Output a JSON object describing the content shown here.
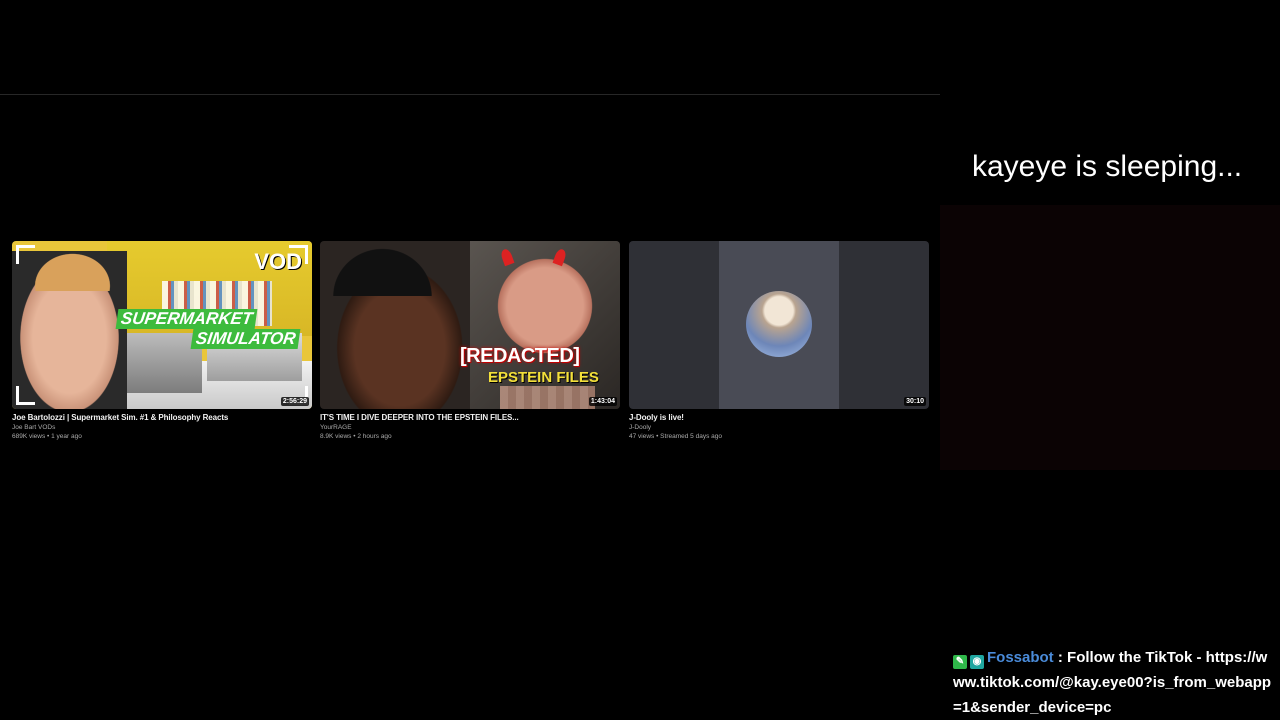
{
  "videos": [
    {
      "title": "Joe Bartolozzi | Supermarket Sim. #1 & Philosophy Reacts",
      "channel": "Joe Bart VODs",
      "stats": "689K views • 1 year ago",
      "duration": "2:56:29",
      "thumb_text": [
        "VOD",
        "SUPERMARKET",
        "SIMULATOR"
      ]
    },
    {
      "title": "IT'S TIME I DIVE DEEPER INTO THE EPSTEIN FILES...",
      "channel": "YourRAGE",
      "stats": "8.9K views • 2 hours ago",
      "duration": "1:43:04",
      "thumb_text": [
        "[REDACTED]",
        "EPSTEIN FILES"
      ]
    },
    {
      "title": "J-Dooly is live!",
      "channel": "J-Dooly",
      "stats": "47 views • Streamed 5 days ago",
      "duration": "30:10"
    }
  ],
  "overlay": {
    "sleep_message": "kayeye is sleeping..."
  },
  "chat": {
    "username": "Fossabot",
    "separator": " : ",
    "message": "Follow the TikTok - https://www.tiktok.com/@kay.eye00?is_from_webapp=1&sender_device=pc",
    "badges": [
      "moderator-badge",
      "bot-badge"
    ]
  }
}
